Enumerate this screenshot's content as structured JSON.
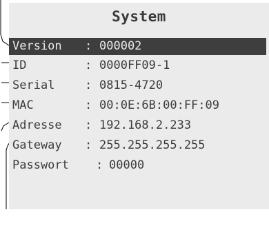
{
  "screen": {
    "title": "System",
    "colors": {
      "background": "#ebebeb",
      "text": "#3c3c3c",
      "highlight_bg": "#3e3e3e",
      "highlight_text": "#eaeaea"
    },
    "rows": [
      {
        "key": "Version",
        "sep": ":",
        "value": "000002",
        "selected": true
      },
      {
        "key": "ID",
        "sep": ":",
        "value": "0000FF09-1"
      },
      {
        "key": "Serial",
        "sep": ":",
        "value": "0815-4720"
      },
      {
        "key": "MAC",
        "sep": ":",
        "value": "00:0E:6B:00:FF:09"
      },
      {
        "key": "Adresse",
        "sep": ":",
        "value": "192.168.2.233"
      },
      {
        "key": "Gateway",
        "sep": ":",
        "value": "255.255.255.255"
      },
      {
        "key": "Passwort",
        "sep": ":",
        "value": "00000"
      }
    ]
  }
}
